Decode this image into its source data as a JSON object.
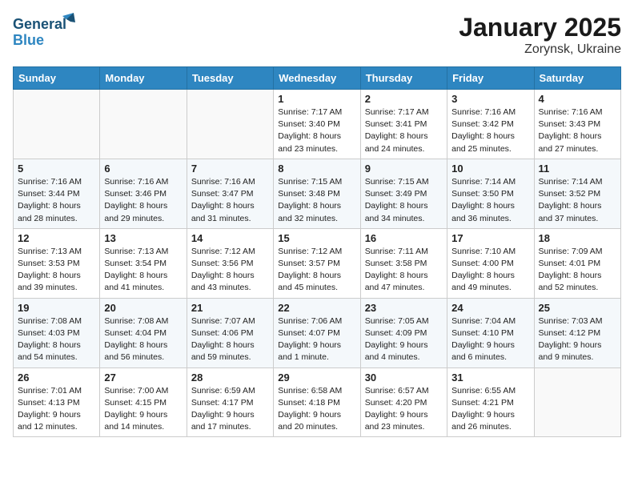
{
  "header": {
    "logo_line1": "General",
    "logo_line2": "Blue",
    "title": "January 2025",
    "subtitle": "Zorynsk, Ukraine"
  },
  "weekdays": [
    "Sunday",
    "Monday",
    "Tuesday",
    "Wednesday",
    "Thursday",
    "Friday",
    "Saturday"
  ],
  "weeks": [
    [
      {
        "day": "",
        "info": ""
      },
      {
        "day": "",
        "info": ""
      },
      {
        "day": "",
        "info": ""
      },
      {
        "day": "1",
        "info": "Sunrise: 7:17 AM\nSunset: 3:40 PM\nDaylight: 8 hours\nand 23 minutes."
      },
      {
        "day": "2",
        "info": "Sunrise: 7:17 AM\nSunset: 3:41 PM\nDaylight: 8 hours\nand 24 minutes."
      },
      {
        "day": "3",
        "info": "Sunrise: 7:16 AM\nSunset: 3:42 PM\nDaylight: 8 hours\nand 25 minutes."
      },
      {
        "day": "4",
        "info": "Sunrise: 7:16 AM\nSunset: 3:43 PM\nDaylight: 8 hours\nand 27 minutes."
      }
    ],
    [
      {
        "day": "5",
        "info": "Sunrise: 7:16 AM\nSunset: 3:44 PM\nDaylight: 8 hours\nand 28 minutes."
      },
      {
        "day": "6",
        "info": "Sunrise: 7:16 AM\nSunset: 3:46 PM\nDaylight: 8 hours\nand 29 minutes."
      },
      {
        "day": "7",
        "info": "Sunrise: 7:16 AM\nSunset: 3:47 PM\nDaylight: 8 hours\nand 31 minutes."
      },
      {
        "day": "8",
        "info": "Sunrise: 7:15 AM\nSunset: 3:48 PM\nDaylight: 8 hours\nand 32 minutes."
      },
      {
        "day": "9",
        "info": "Sunrise: 7:15 AM\nSunset: 3:49 PM\nDaylight: 8 hours\nand 34 minutes."
      },
      {
        "day": "10",
        "info": "Sunrise: 7:14 AM\nSunset: 3:50 PM\nDaylight: 8 hours\nand 36 minutes."
      },
      {
        "day": "11",
        "info": "Sunrise: 7:14 AM\nSunset: 3:52 PM\nDaylight: 8 hours\nand 37 minutes."
      }
    ],
    [
      {
        "day": "12",
        "info": "Sunrise: 7:13 AM\nSunset: 3:53 PM\nDaylight: 8 hours\nand 39 minutes."
      },
      {
        "day": "13",
        "info": "Sunrise: 7:13 AM\nSunset: 3:54 PM\nDaylight: 8 hours\nand 41 minutes."
      },
      {
        "day": "14",
        "info": "Sunrise: 7:12 AM\nSunset: 3:56 PM\nDaylight: 8 hours\nand 43 minutes."
      },
      {
        "day": "15",
        "info": "Sunrise: 7:12 AM\nSunset: 3:57 PM\nDaylight: 8 hours\nand 45 minutes."
      },
      {
        "day": "16",
        "info": "Sunrise: 7:11 AM\nSunset: 3:58 PM\nDaylight: 8 hours\nand 47 minutes."
      },
      {
        "day": "17",
        "info": "Sunrise: 7:10 AM\nSunset: 4:00 PM\nDaylight: 8 hours\nand 49 minutes."
      },
      {
        "day": "18",
        "info": "Sunrise: 7:09 AM\nSunset: 4:01 PM\nDaylight: 8 hours\nand 52 minutes."
      }
    ],
    [
      {
        "day": "19",
        "info": "Sunrise: 7:08 AM\nSunset: 4:03 PM\nDaylight: 8 hours\nand 54 minutes."
      },
      {
        "day": "20",
        "info": "Sunrise: 7:08 AM\nSunset: 4:04 PM\nDaylight: 8 hours\nand 56 minutes."
      },
      {
        "day": "21",
        "info": "Sunrise: 7:07 AM\nSunset: 4:06 PM\nDaylight: 8 hours\nand 59 minutes."
      },
      {
        "day": "22",
        "info": "Sunrise: 7:06 AM\nSunset: 4:07 PM\nDaylight: 9 hours\nand 1 minute."
      },
      {
        "day": "23",
        "info": "Sunrise: 7:05 AM\nSunset: 4:09 PM\nDaylight: 9 hours\nand 4 minutes."
      },
      {
        "day": "24",
        "info": "Sunrise: 7:04 AM\nSunset: 4:10 PM\nDaylight: 9 hours\nand 6 minutes."
      },
      {
        "day": "25",
        "info": "Sunrise: 7:03 AM\nSunset: 4:12 PM\nDaylight: 9 hours\nand 9 minutes."
      }
    ],
    [
      {
        "day": "26",
        "info": "Sunrise: 7:01 AM\nSunset: 4:13 PM\nDaylight: 9 hours\nand 12 minutes."
      },
      {
        "day": "27",
        "info": "Sunrise: 7:00 AM\nSunset: 4:15 PM\nDaylight: 9 hours\nand 14 minutes."
      },
      {
        "day": "28",
        "info": "Sunrise: 6:59 AM\nSunset: 4:17 PM\nDaylight: 9 hours\nand 17 minutes."
      },
      {
        "day": "29",
        "info": "Sunrise: 6:58 AM\nSunset: 4:18 PM\nDaylight: 9 hours\nand 20 minutes."
      },
      {
        "day": "30",
        "info": "Sunrise: 6:57 AM\nSunset: 4:20 PM\nDaylight: 9 hours\nand 23 minutes."
      },
      {
        "day": "31",
        "info": "Sunrise: 6:55 AM\nSunset: 4:21 PM\nDaylight: 9 hours\nand 26 minutes."
      },
      {
        "day": "",
        "info": ""
      }
    ]
  ]
}
